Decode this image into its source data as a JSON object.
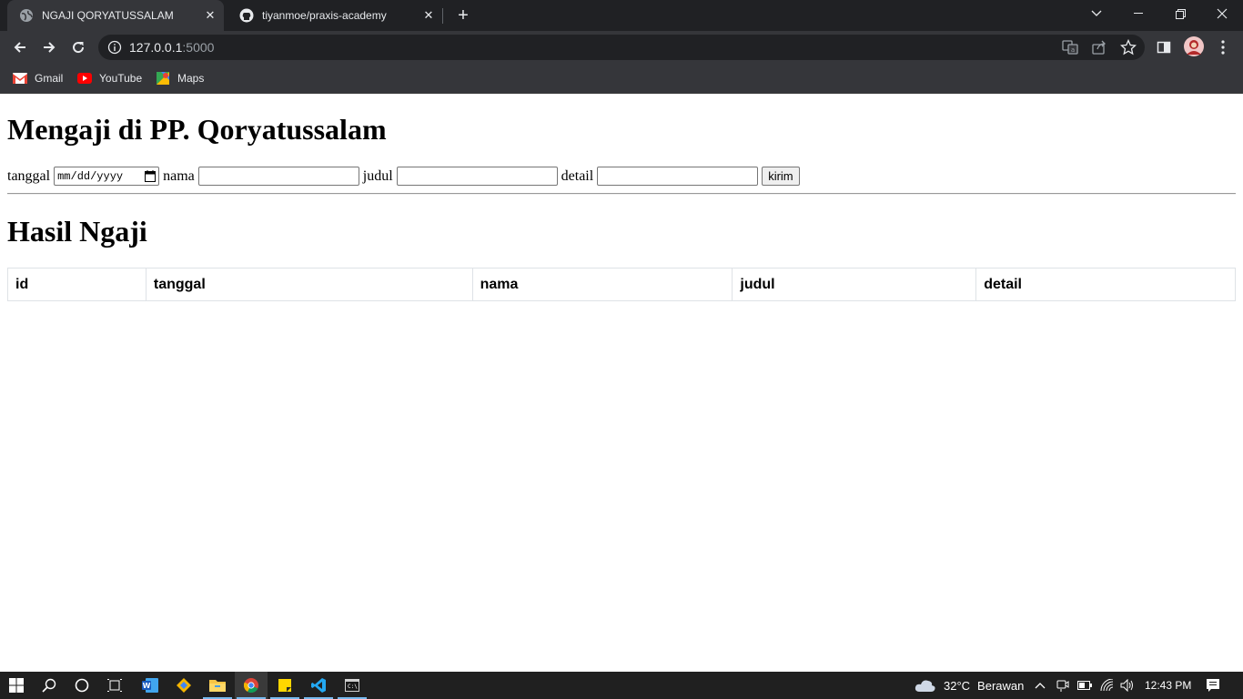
{
  "browser": {
    "tabs": [
      {
        "title": "NGAJI QORYATUSSALAM",
        "active": true
      },
      {
        "title": "tiyanmoe/praxis-academy",
        "active": false
      }
    ],
    "url_host": "127.0.0.1",
    "url_port": ":5000",
    "bookmarks": [
      {
        "label": "Gmail",
        "icon": "gmail-icon"
      },
      {
        "label": "YouTube",
        "icon": "youtube-icon"
      },
      {
        "label": "Maps",
        "icon": "maps-icon"
      }
    ]
  },
  "page": {
    "heading": "Mengaji di PP. Qoryatussalam",
    "form": {
      "tanggal_label": "tanggal",
      "tanggal_placeholder": "mm/dd/yyyy",
      "nama_label": "nama",
      "judul_label": "judul",
      "detail_label": "detail",
      "submit_label": "kirim"
    },
    "results_heading": "Hasil Ngaji",
    "table": {
      "columns": [
        "id",
        "tanggal",
        "nama",
        "judul",
        "detail"
      ],
      "rows": []
    }
  },
  "taskbar": {
    "weather_temp": "32°C",
    "weather_text": "Berawan",
    "clock": "12:43 PM"
  }
}
